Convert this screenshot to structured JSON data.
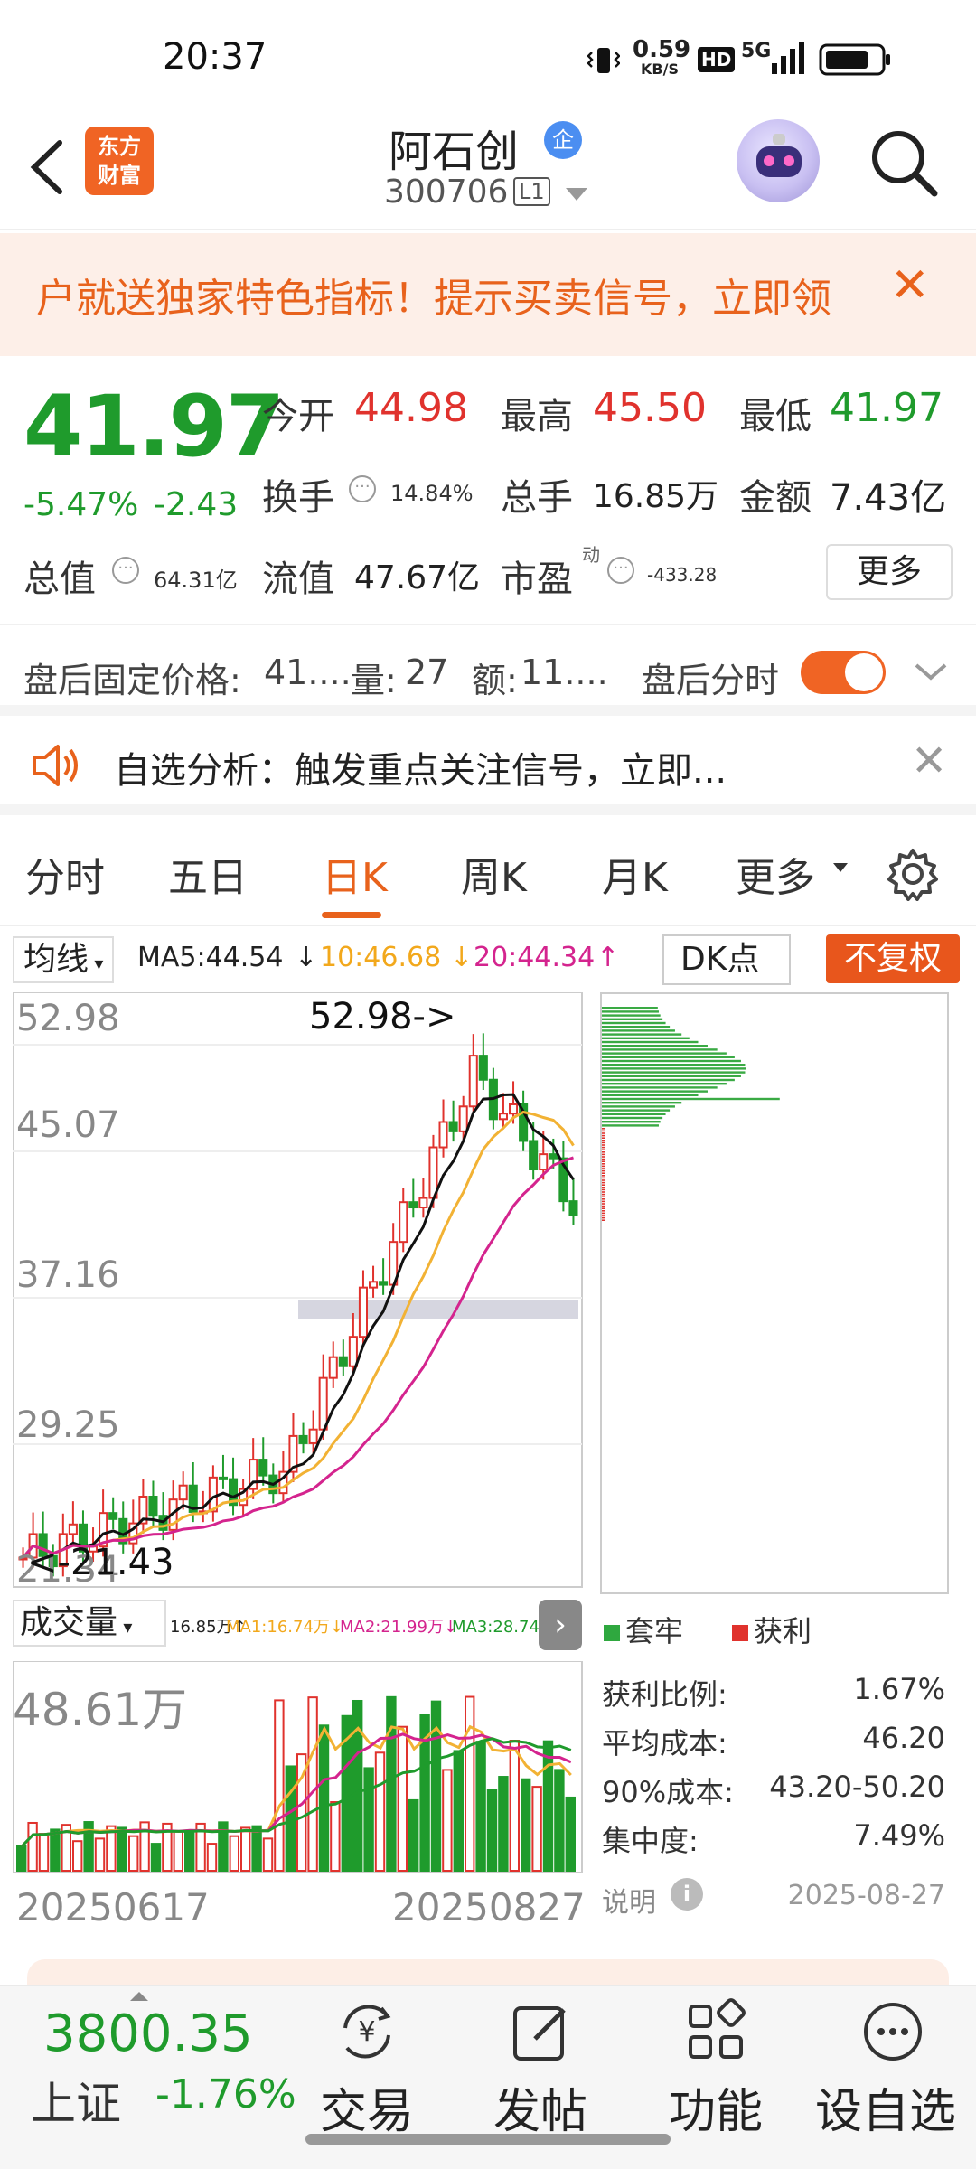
{
  "status_bar": {
    "time": "20:37",
    "net_speed": "0.59",
    "net_unit": "KB/S",
    "hd": "HD",
    "signal": "5G"
  },
  "header": {
    "logo_line1": "东方",
    "logo_line2": "财富",
    "stock_name": "阿石创",
    "badge": "企",
    "stock_code": "300706",
    "level": "L1"
  },
  "promo": {
    "text": "户就送独家特色指标！提示买卖信号，立即领",
    "close": "✕"
  },
  "quote": {
    "price": "41.97",
    "change_pct": "-5.47%",
    "change_amt": "-2.43",
    "open_label": "今开",
    "open": "44.98",
    "high_label": "最高",
    "high": "45.50",
    "low_label": "最低",
    "low": "41.97",
    "turnover_label": "换手",
    "turnover": "14.84%",
    "volume_label": "总手",
    "volume": "16.85万",
    "amount_label": "金额",
    "amount": "7.43亿",
    "mktcap_label": "总值",
    "mktcap": "64.31亿",
    "float_label": "流值",
    "float": "47.67亿",
    "pe_label": "市盈",
    "pe_sup": "动",
    "pe": "-433.28",
    "more": "更多"
  },
  "after_hours": {
    "price_label": "盘后固定价格:",
    "price": "41....",
    "vol_label": "量:",
    "vol": "27",
    "amt_label": "额:",
    "amt": "11....",
    "toggle_label": "盘后分时"
  },
  "analysis": {
    "text": "自选分析：触发重点关注信号，立即..."
  },
  "tabs": [
    "分时",
    "五日",
    "日K",
    "周K",
    "月K",
    "更多"
  ],
  "ma_row": {
    "select": "均线",
    "ma5": "MA5:44.54",
    "ma10": "10:46.68",
    "ma20": "20:44.34",
    "dk": "DK点",
    "fq": "不复权"
  },
  "kchart": {
    "y_labels": [
      "52.98",
      "45.07",
      "37.16",
      "29.25",
      "21.34"
    ],
    "max_marker": "52.98->",
    "min_marker": "<-21.43"
  },
  "volume_panel": {
    "select": "成交量",
    "legend_vol": "16.85万↑",
    "legend_ma1": "MA1:16.74万↓",
    "legend_ma2": "MA2:21.99万↓",
    "legend_ma3": "MA3:28.74万↓",
    "max": "48.61万",
    "date_start": "20250617",
    "date_end": "20250827"
  },
  "chip": {
    "legend_trapped": "套牢",
    "legend_profit": "获利",
    "rows": [
      {
        "label": "获利比例:",
        "value": "1.67%"
      },
      {
        "label": "平均成本:",
        "value": "46.20"
      },
      {
        "label": "90%成本:",
        "value": "43.20-50.20"
      },
      {
        "label": "集中度:",
        "value": "7.49%"
      }
    ],
    "note": "说明",
    "date": "2025-08-27"
  },
  "colors": {
    "up": "#e0322d",
    "down": "#1f9b2c",
    "accent": "#e8621c"
  },
  "bottom_bar": {
    "index_value": "3800.35",
    "index_name": "上证",
    "index_pct": "-1.76%",
    "nav": [
      "交易",
      "发帖",
      "功能",
      "设自选"
    ]
  }
}
